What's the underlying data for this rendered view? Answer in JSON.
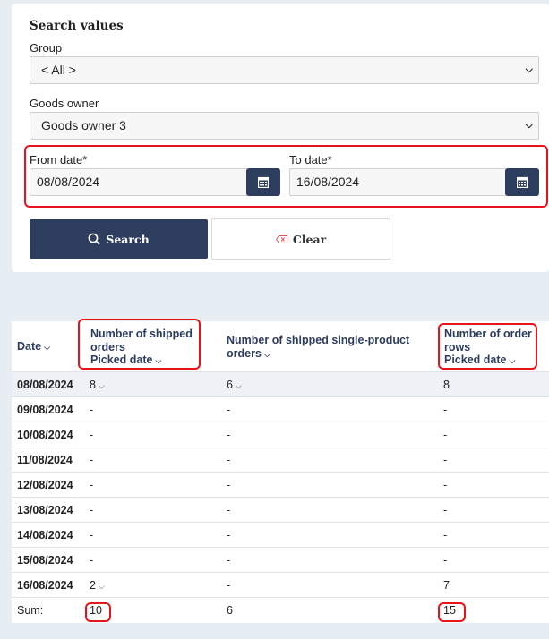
{
  "search_panel": {
    "title": "Search values",
    "group": {
      "label": "Group",
      "value": "< All >"
    },
    "goods_owner": {
      "label": "Goods owner",
      "value": "Goods owner 3"
    },
    "from_date": {
      "label": "From date*",
      "value": "08/08/2024"
    },
    "to_date": {
      "label": "To date*",
      "value": "16/08/2024"
    },
    "search_button": "Search",
    "clear_button": "Clear"
  },
  "table": {
    "headers": {
      "date": "Date",
      "shipped_orders": [
        "Number of shipped",
        "orders",
        "Picked date"
      ],
      "single_product": [
        "Number of shipped single-product",
        "orders"
      ],
      "order_rows": [
        "Number of order",
        "rows",
        "Picked date"
      ]
    },
    "rows": [
      {
        "date": "08/08/2024",
        "shipped": "8",
        "single": "6",
        "rows": "8"
      },
      {
        "date": "09/08/2024",
        "shipped": "-",
        "single": "-",
        "rows": "-"
      },
      {
        "date": "10/08/2024",
        "shipped": "-",
        "single": "-",
        "rows": "-"
      },
      {
        "date": "11/08/2024",
        "shipped": "-",
        "single": "-",
        "rows": "-"
      },
      {
        "date": "12/08/2024",
        "shipped": "-",
        "single": "-",
        "rows": "-"
      },
      {
        "date": "13/08/2024",
        "shipped": "-",
        "single": "-",
        "rows": "-"
      },
      {
        "date": "14/08/2024",
        "shipped": "-",
        "single": "-",
        "rows": "-"
      },
      {
        "date": "15/08/2024",
        "shipped": "-",
        "single": "-",
        "rows": "-"
      },
      {
        "date": "16/08/2024",
        "shipped": "2",
        "single": "-",
        "rows": "7"
      }
    ],
    "sum": {
      "label": "Sum:",
      "shipped": "10",
      "single": "6",
      "rows": "15"
    }
  },
  "colors": {
    "primary": "#2d3d5e",
    "highlight": "#e8141c",
    "background": "#e6edf3"
  }
}
